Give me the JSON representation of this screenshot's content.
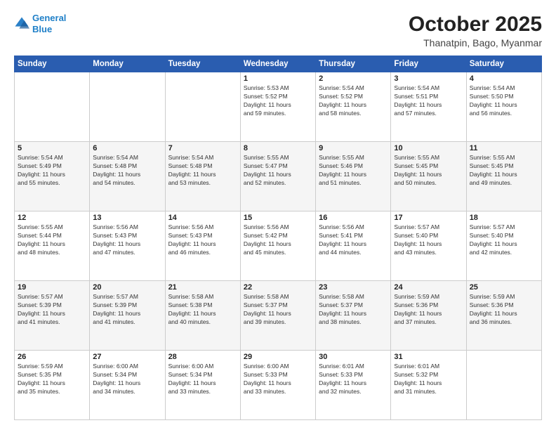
{
  "header": {
    "logo_line1": "General",
    "logo_line2": "Blue",
    "month": "October 2025",
    "location": "Thanatpin, Bago, Myanmar"
  },
  "weekdays": [
    "Sunday",
    "Monday",
    "Tuesday",
    "Wednesday",
    "Thursday",
    "Friday",
    "Saturday"
  ],
  "weeks": [
    [
      {
        "day": "",
        "info": ""
      },
      {
        "day": "",
        "info": ""
      },
      {
        "day": "",
        "info": ""
      },
      {
        "day": "1",
        "info": "Sunrise: 5:53 AM\nSunset: 5:52 PM\nDaylight: 11 hours\nand 59 minutes."
      },
      {
        "day": "2",
        "info": "Sunrise: 5:54 AM\nSunset: 5:52 PM\nDaylight: 11 hours\nand 58 minutes."
      },
      {
        "day": "3",
        "info": "Sunrise: 5:54 AM\nSunset: 5:51 PM\nDaylight: 11 hours\nand 57 minutes."
      },
      {
        "day": "4",
        "info": "Sunrise: 5:54 AM\nSunset: 5:50 PM\nDaylight: 11 hours\nand 56 minutes."
      }
    ],
    [
      {
        "day": "5",
        "info": "Sunrise: 5:54 AM\nSunset: 5:49 PM\nDaylight: 11 hours\nand 55 minutes."
      },
      {
        "day": "6",
        "info": "Sunrise: 5:54 AM\nSunset: 5:48 PM\nDaylight: 11 hours\nand 54 minutes."
      },
      {
        "day": "7",
        "info": "Sunrise: 5:54 AM\nSunset: 5:48 PM\nDaylight: 11 hours\nand 53 minutes."
      },
      {
        "day": "8",
        "info": "Sunrise: 5:55 AM\nSunset: 5:47 PM\nDaylight: 11 hours\nand 52 minutes."
      },
      {
        "day": "9",
        "info": "Sunrise: 5:55 AM\nSunset: 5:46 PM\nDaylight: 11 hours\nand 51 minutes."
      },
      {
        "day": "10",
        "info": "Sunrise: 5:55 AM\nSunset: 5:45 PM\nDaylight: 11 hours\nand 50 minutes."
      },
      {
        "day": "11",
        "info": "Sunrise: 5:55 AM\nSunset: 5:45 PM\nDaylight: 11 hours\nand 49 minutes."
      }
    ],
    [
      {
        "day": "12",
        "info": "Sunrise: 5:55 AM\nSunset: 5:44 PM\nDaylight: 11 hours\nand 48 minutes."
      },
      {
        "day": "13",
        "info": "Sunrise: 5:56 AM\nSunset: 5:43 PM\nDaylight: 11 hours\nand 47 minutes."
      },
      {
        "day": "14",
        "info": "Sunrise: 5:56 AM\nSunset: 5:43 PM\nDaylight: 11 hours\nand 46 minutes."
      },
      {
        "day": "15",
        "info": "Sunrise: 5:56 AM\nSunset: 5:42 PM\nDaylight: 11 hours\nand 45 minutes."
      },
      {
        "day": "16",
        "info": "Sunrise: 5:56 AM\nSunset: 5:41 PM\nDaylight: 11 hours\nand 44 minutes."
      },
      {
        "day": "17",
        "info": "Sunrise: 5:57 AM\nSunset: 5:40 PM\nDaylight: 11 hours\nand 43 minutes."
      },
      {
        "day": "18",
        "info": "Sunrise: 5:57 AM\nSunset: 5:40 PM\nDaylight: 11 hours\nand 42 minutes."
      }
    ],
    [
      {
        "day": "19",
        "info": "Sunrise: 5:57 AM\nSunset: 5:39 PM\nDaylight: 11 hours\nand 41 minutes."
      },
      {
        "day": "20",
        "info": "Sunrise: 5:57 AM\nSunset: 5:39 PM\nDaylight: 11 hours\nand 41 minutes."
      },
      {
        "day": "21",
        "info": "Sunrise: 5:58 AM\nSunset: 5:38 PM\nDaylight: 11 hours\nand 40 minutes."
      },
      {
        "day": "22",
        "info": "Sunrise: 5:58 AM\nSunset: 5:37 PM\nDaylight: 11 hours\nand 39 minutes."
      },
      {
        "day": "23",
        "info": "Sunrise: 5:58 AM\nSunset: 5:37 PM\nDaylight: 11 hours\nand 38 minutes."
      },
      {
        "day": "24",
        "info": "Sunrise: 5:59 AM\nSunset: 5:36 PM\nDaylight: 11 hours\nand 37 minutes."
      },
      {
        "day": "25",
        "info": "Sunrise: 5:59 AM\nSunset: 5:36 PM\nDaylight: 11 hours\nand 36 minutes."
      }
    ],
    [
      {
        "day": "26",
        "info": "Sunrise: 5:59 AM\nSunset: 5:35 PM\nDaylight: 11 hours\nand 35 minutes."
      },
      {
        "day": "27",
        "info": "Sunrise: 6:00 AM\nSunset: 5:34 PM\nDaylight: 11 hours\nand 34 minutes."
      },
      {
        "day": "28",
        "info": "Sunrise: 6:00 AM\nSunset: 5:34 PM\nDaylight: 11 hours\nand 33 minutes."
      },
      {
        "day": "29",
        "info": "Sunrise: 6:00 AM\nSunset: 5:33 PM\nDaylight: 11 hours\nand 33 minutes."
      },
      {
        "day": "30",
        "info": "Sunrise: 6:01 AM\nSunset: 5:33 PM\nDaylight: 11 hours\nand 32 minutes."
      },
      {
        "day": "31",
        "info": "Sunrise: 6:01 AM\nSunset: 5:32 PM\nDaylight: 11 hours\nand 31 minutes."
      },
      {
        "day": "",
        "info": ""
      }
    ]
  ]
}
